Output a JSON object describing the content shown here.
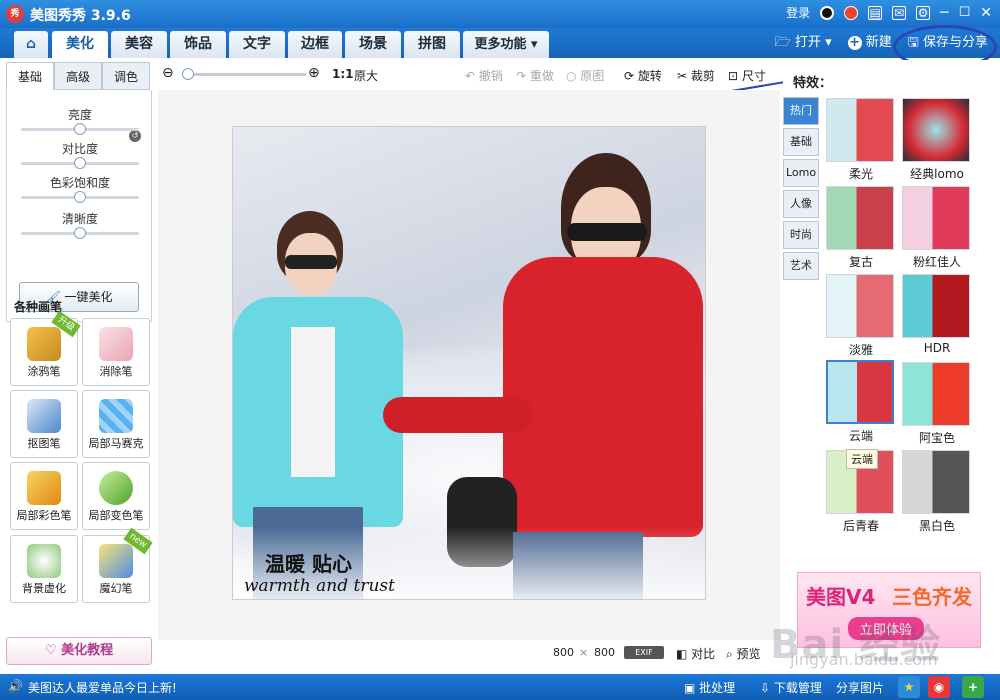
{
  "app": {
    "logo_text": "秀",
    "title": "美图秀秀 3.9.6"
  },
  "titlebar": {
    "login": "登录"
  },
  "menu": {
    "tabs": [
      "美化",
      "美容",
      "饰品",
      "文字",
      "边框",
      "场景",
      "拼图",
      "更多功能"
    ],
    "active_tab": "美化",
    "open_label": "打开",
    "new_label": "新建",
    "save_label": "保存与分享"
  },
  "left": {
    "subtabs": [
      "基础",
      "高级",
      "调色"
    ],
    "sliders": [
      {
        "label": "亮度",
        "level": 0.5
      },
      {
        "label": "对比度",
        "level": 0.5
      },
      {
        "label": "色彩饱和度",
        "level": 0.5
      },
      {
        "label": "清晰度",
        "level": 0.5
      }
    ],
    "one_key": "一键美化",
    "brushes_title": "各种画笔",
    "brushes": [
      {
        "label": "涂鸦笔",
        "badge": "升级"
      },
      {
        "label": "消除笔",
        "badge": ""
      },
      {
        "label": "抠图笔",
        "badge": ""
      },
      {
        "label": "局部马赛克",
        "badge": ""
      },
      {
        "label": "局部彩色笔",
        "badge": ""
      },
      {
        "label": "局部变色笔",
        "badge": ""
      },
      {
        "label": "背景虚化",
        "badge": ""
      },
      {
        "label": "魔幻笔",
        "badge": "new"
      }
    ],
    "tutorial": "美化教程"
  },
  "toolbar": {
    "zoom_1to1": "1:1",
    "original_size": "原大",
    "undo": "撤销",
    "redo": "重做",
    "original": "原图",
    "rotate": "旋转",
    "crop": "裁剪",
    "size": "尺寸"
  },
  "photo": {
    "caption_cn": "温暖 贴心",
    "caption_en": "warmth and trust"
  },
  "bottom": {
    "width": "800",
    "times": "×",
    "height": "800",
    "exif": "EXIF",
    "compare": "对比",
    "preview": "预览"
  },
  "effects": {
    "title": "特效：",
    "categories": [
      "热门",
      "基础",
      "Lomo",
      "人像",
      "时尚",
      "艺术"
    ],
    "active_category": "热门",
    "items": [
      "柔光",
      "经典lomo",
      "复古",
      "粉红佳人",
      "淡雅",
      "HDR",
      "云端",
      "阿宝色",
      "后青春",
      "黑白色"
    ],
    "selected": "云端",
    "tooltip": "云端"
  },
  "ad": {
    "text1": "美图V4",
    "text2": "三色齐发",
    "text3": "立即体验"
  },
  "watermark": {
    "text": "Bai 经验",
    "url": "jingyan.baidu.com"
  },
  "status": {
    "news": "美图达人最爱单品今日上新!",
    "batch": "批处理",
    "download": "下载管理",
    "share": "分享图片"
  },
  "colors": {
    "titlebar": "#1a6fc9",
    "accent": "#3a7fd0",
    "jacket_red": "#d8222c",
    "jacket_cyan": "#5fd8e4"
  }
}
